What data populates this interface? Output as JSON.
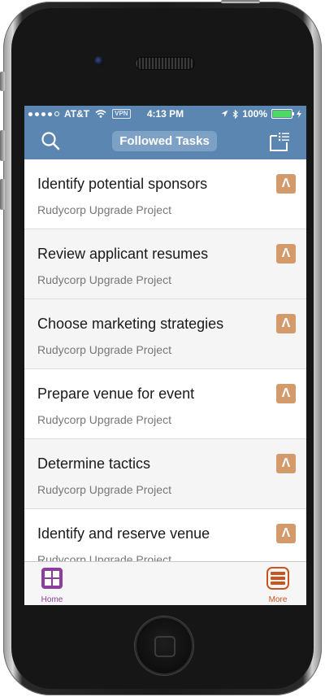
{
  "status_bar": {
    "carrier": "AT&T",
    "vpn": "VPN",
    "time": "4:13 PM",
    "battery": "100%"
  },
  "nav": {
    "title": "Followed Tasks",
    "search_icon": "search-icon",
    "list_icon": "list-icon"
  },
  "tasks": [
    {
      "title": "Identify potential sponsors",
      "project": "Rudycorp Upgrade Project",
      "badge": "Λ"
    },
    {
      "title": "Review applicant resumes",
      "project": "Rudycorp Upgrade Project",
      "badge": "Λ"
    },
    {
      "title": "Choose marketing strategies",
      "project": "Rudycorp Upgrade Project",
      "badge": "Λ"
    },
    {
      "title": "Prepare venue for event",
      "project": "Rudycorp Upgrade Project",
      "badge": "Λ"
    },
    {
      "title": "Determine tactics",
      "project": "Rudycorp Upgrade Project",
      "badge": "Λ"
    },
    {
      "title": "Identify and reserve venue",
      "project": "Rudycorp Upgrade Project",
      "badge": "Λ"
    }
  ],
  "tabbar": {
    "home_label": "Home",
    "more_label": "More"
  },
  "colors": {
    "header": "#5b86b2",
    "title_pill": "#7da1c4",
    "badge": "#d39a6b",
    "home_tab": "#8d3d9b",
    "more_tab": "#c8541e"
  }
}
